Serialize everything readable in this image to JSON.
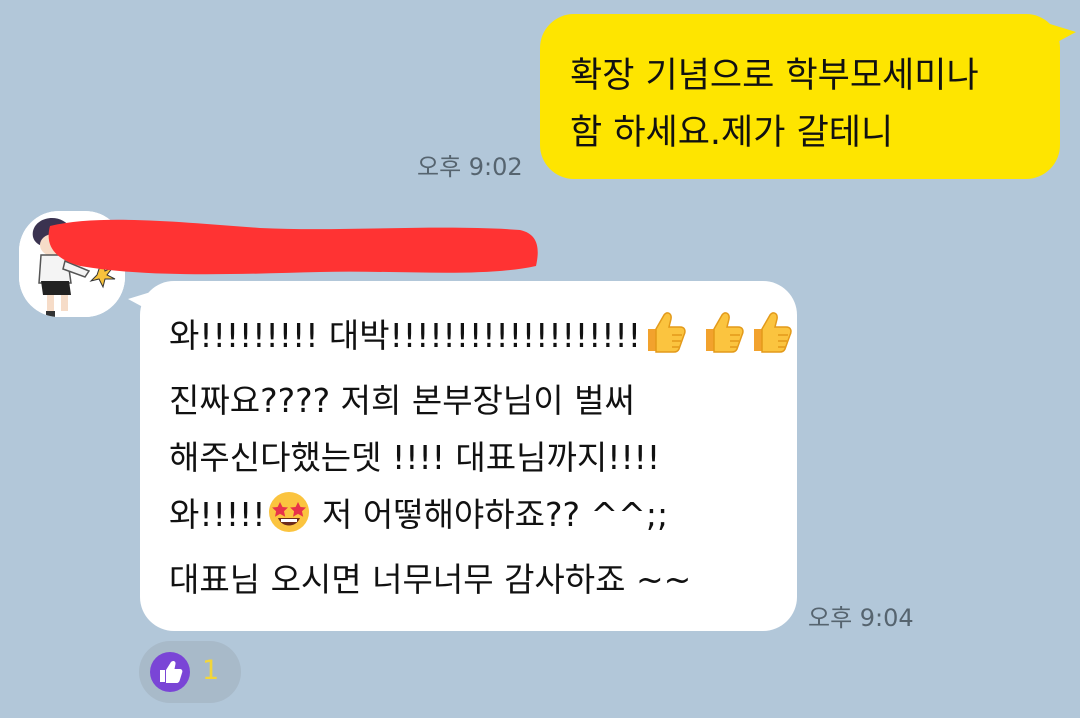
{
  "messages": {
    "outgoing": {
      "text": "확장 기념으로 학부모세미나\n함 하세요.제가 갈테니",
      "time": "오후 9:02"
    },
    "incoming": {
      "lines": [
        [
          "와!!!!!!!!! 대박!!!!!!!!!!!!!!!!!!!",
          "thumbs-up",
          " ",
          "thumbs-up",
          "thumbs-up"
        ],
        [
          "진짜요???? 저희 본부장님이 벌써"
        ],
        [
          "해주신다했는뎃 !!!! 대표님까지!!!!"
        ],
        [
          "와!!!!!",
          "star-struck",
          " 저 어떻해야하죠?? ^^;;"
        ],
        [
          "대표님 오시면 너무너무 감사하죠 ~~"
        ]
      ],
      "l1a": "와!!!!!!!!! 대박!!!!!!!!!!!!!!!!!!!",
      "l2": "진짜요???? 저희 본부장님이 벌써",
      "l3": "해주신다했는뎃 !!!! 대표님까지!!!!",
      "l4a": "와!!!!!",
      "l4b": " 저 어떻해야하죠?? ^^;;",
      "l5": "대표님 오시면 너무너무 감사하죠 ~~",
      "time": "오후 9:04",
      "sender_redacted": true
    }
  },
  "reaction": {
    "icon": "thumbs-up-icon",
    "count": "1"
  },
  "colors": {
    "background": "#b2c7d9",
    "bubble_outgoing": "#fee500",
    "bubble_incoming": "#ffffff",
    "redaction": "#ff3333",
    "reaction_icon": "#7a45d6"
  }
}
